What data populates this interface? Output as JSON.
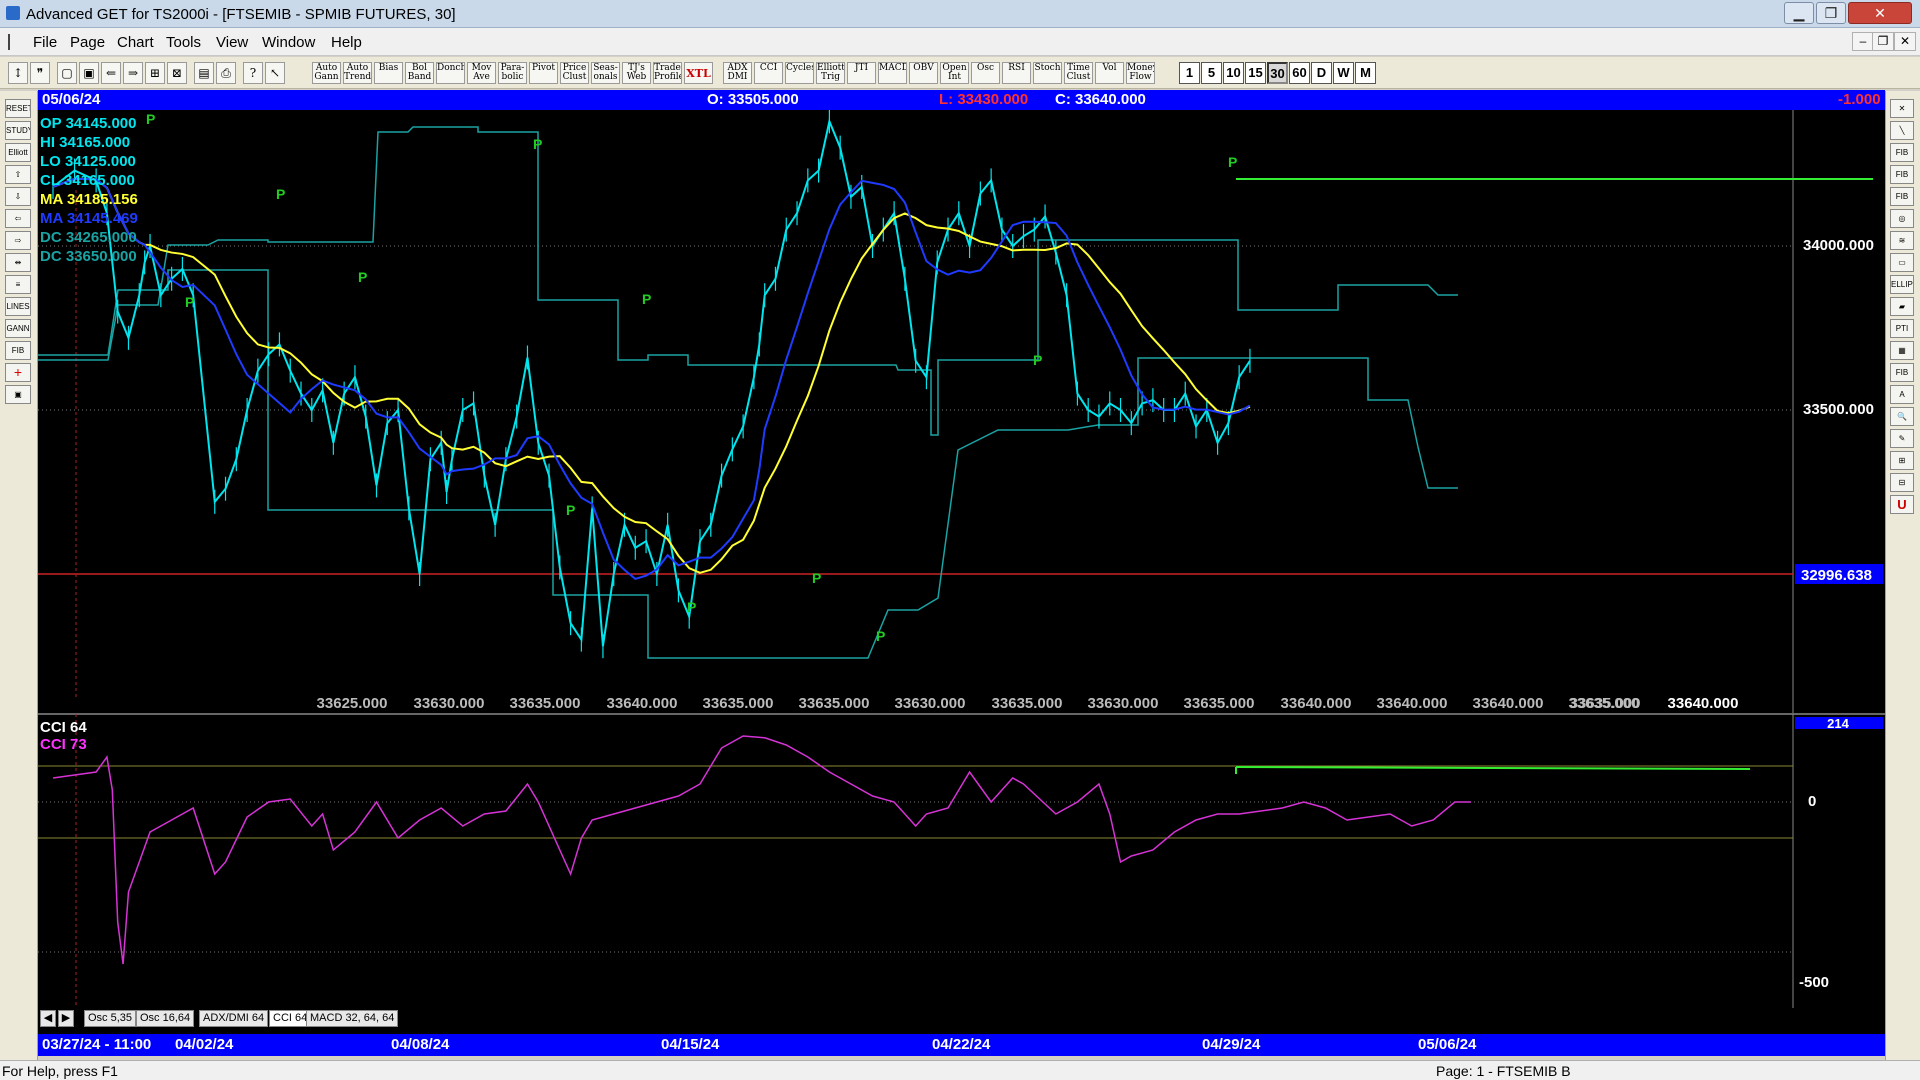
{
  "window": {
    "title": "Advanced GET for TS2000i - [FTSEMIB - SPMIB FUTURES, 30]",
    "minimize": "▁",
    "maximize": "❐",
    "close": "✕"
  },
  "menu": [
    "File",
    "Page",
    "Chart",
    "Tools",
    "View",
    "Window",
    "Help"
  ],
  "mdi_buttons": [
    "‒",
    "❐",
    "✕"
  ],
  "toolbar": {
    "studies": [
      "Auto Gann",
      "Auto Trend",
      "Bias",
      "Bol Band",
      "Donch",
      "Mov Ave",
      "Para- bolic",
      "Pivot",
      "Price Clust",
      "Seas- onals",
      "TJ's Web",
      "Trade Profile",
      "XTL",
      "ADX DMI",
      "CCI",
      "Cycles",
      "Elliott Trig",
      "JTI",
      "MACD",
      "OBV",
      "Open Int",
      "Osc",
      "RSI",
      "Stoch",
      "Time Clust",
      "Vol",
      "Money Flow"
    ],
    "timeframes": [
      "1",
      "5",
      "10",
      "15",
      "30",
      "60",
      "D",
      "W",
      "M"
    ],
    "active_timeframe": "30"
  },
  "left_tools": [
    "RESET",
    "STUDY",
    "Elliott",
    "⇧",
    "⇩",
    "⇦",
    "⇨",
    "⇹",
    "≡",
    "LINES",
    "GANN",
    "FIB",
    "+",
    "▣"
  ],
  "right_tools": [
    "✕",
    "╲",
    "FIB RET",
    "FIB EXT",
    "FIB TIME",
    "◎",
    "≋",
    "▭",
    "ELLIPS",
    "▰",
    "PTI",
    "▦",
    "FIB",
    "A",
    "🔍",
    "✎",
    "⊞",
    "⊟",
    "U"
  ],
  "infobar": {
    "date": "05/06/24",
    "open": "O: 33505.000",
    "low": "L: 33430.000",
    "close": "C: 33640.000",
    "change": "-1.000"
  },
  "legend": [
    {
      "text": "OP  34145.000",
      "color": "#00e5ee"
    },
    {
      "text": "HI   34165.000",
      "color": "#00e5ee"
    },
    {
      "text": "LO  34125.000",
      "color": "#00e5ee"
    },
    {
      "text": "CL  34165.000",
      "color": "#00e5ee"
    },
    {
      "text": "MA  34185.156",
      "color": "#ffff33"
    },
    {
      "text": "MA  34145.469",
      "color": "#1f3bff"
    },
    {
      "text": "DC  34265.000",
      "color": "#1aa3a3"
    },
    {
      "text": "DC  33650.000",
      "color": "#1aa3a3"
    }
  ],
  "cci_legend": [
    {
      "text": "CCI 64",
      "color": "#ffffff"
    },
    {
      "text": "CCI  73",
      "color": "#ff33ff"
    }
  ],
  "price_labels": [
    "34000.000",
    "33500.000"
  ],
  "red_line_value": "32996.638",
  "cci_labels": [
    "214",
    "0",
    "-500"
  ],
  "bottom_values": [
    "33625.000",
    "33630.000",
    "33635.000",
    "33640.000",
    "33635.000",
    "33635.000",
    "33630.000",
    "33635.000",
    "33630.000",
    "33635.000",
    "33640.000",
    "33640.000",
    "33640.000",
    "33635.000",
    "33640.000"
  ],
  "tabs": [
    "Osc 5,35",
    "Osc 16,64",
    "ADX/DMI 64",
    "CCI 64",
    "MACD 32, 64, 64"
  ],
  "dates": [
    "03/27/24 - 11:00",
    "04/02/24",
    "04/08/24",
    "04/15/24",
    "04/22/24",
    "04/29/24",
    "05/06/24"
  ],
  "status": {
    "help": "For Help, press F1",
    "page": "Page: 1 - FTSEMIB B"
  },
  "chart_data": [
    {
      "type": "line",
      "name": "price",
      "x": [
        0,
        4,
        8,
        10,
        12,
        14,
        16,
        17,
        18,
        20,
        22,
        24,
        26,
        30,
        32,
        34,
        36,
        38,
        40,
        42,
        44,
        46,
        48,
        50,
        52,
        54,
        56,
        58,
        60,
        62,
        64,
        66,
        68,
        70,
        72,
        73,
        74,
        76,
        78,
        80,
        82,
        84,
        86,
        88,
        90,
        92,
        94,
        96,
        98,
        100,
        102,
        104,
        106,
        108,
        110,
        112,
        114,
        116,
        118,
        120,
        122,
        124,
        126,
        128,
        130,
        131,
        132,
        134,
        136,
        138,
        140,
        142,
        144,
        146,
        148,
        150,
        152,
        154,
        156,
        158,
        160,
        162,
        164,
        166,
        168,
        170,
        172,
        174,
        176,
        178,
        180,
        182,
        184,
        186,
        188,
        190,
        192,
        194,
        196,
        198,
        200,
        202,
        204,
        206,
        208,
        210,
        212,
        214,
        216,
        218,
        220,
        222,
        224,
        226,
        228,
        230,
        232,
        234,
        236,
        238,
        240,
        242,
        244,
        246,
        248,
        250,
        252,
        254,
        256,
        258,
        260,
        262,
        263
      ],
      "y": [
        34180,
        34230,
        34200,
        34100,
        33800,
        33720,
        33850,
        33950,
        34000,
        33850,
        33900,
        33930,
        33850,
        33220,
        33260,
        33350,
        33500,
        33620,
        33670,
        33700,
        33620,
        33550,
        33500,
        33560,
        33400,
        33550,
        33600,
        33480,
        33270,
        33460,
        33500,
        33200,
        33000,
        33350,
        33400,
        33250,
        33350,
        33500,
        33520,
        33300,
        33150,
        33350,
        33480,
        33660,
        33400,
        33300,
        33020,
        32850,
        32800,
        33200,
        32780,
        33000,
        33150,
        33080,
        33100,
        33000,
        33150,
        32950,
        32870,
        33100,
        33150,
        33300,
        33380,
        33450,
        33600,
        33700,
        33850,
        33900,
        34050,
        34100,
        34200,
        34230,
        34380,
        34300,
        34150,
        34180,
        34000,
        34050,
        34100,
        33900,
        33650,
        33600,
        33950,
        34050,
        34100,
        34000,
        34160,
        34200,
        34050,
        34000,
        34030,
        34050,
        34090,
        33980,
        33850,
        33550,
        33500,
        33480,
        33520,
        33500,
        33460,
        33520,
        33530,
        33500,
        33500,
        33550,
        33450,
        33500,
        33400,
        33460,
        33600,
        33650
      ]
    },
    {
      "type": "line",
      "name": "CCI",
      "x": [
        0,
        4,
        8,
        10,
        11,
        12,
        13,
        14,
        16,
        18,
        20,
        24,
        26,
        30,
        32,
        36,
        40,
        44,
        48,
        50,
        52,
        56,
        60,
        64,
        68,
        72,
        76,
        80,
        84,
        88,
        90,
        96,
        98,
        100,
        104,
        108,
        112,
        116,
        120,
        124,
        128,
        132,
        136,
        140,
        144,
        148,
        152,
        156,
        160,
        162,
        166,
        170,
        174,
        178,
        180,
        186,
        190,
        194,
        196,
        198,
        200,
        204,
        208,
        212,
        216,
        220,
        224,
        228,
        232,
        236,
        240,
        244,
        248,
        252,
        256,
        260,
        263
      ],
      "y": [
        80,
        90,
        100,
        150,
        40,
        -400,
        -540,
        -300,
        -200,
        -100,
        -80,
        -40,
        -20,
        -240,
        -200,
        -50,
        0,
        10,
        -80,
        -40,
        -160,
        -100,
        0,
        -120,
        -60,
        -20,
        -80,
        -40,
        -30,
        60,
        0,
        -240,
        -120,
        -60,
        -40,
        -20,
        0,
        20,
        60,
        180,
        220,
        214,
        190,
        150,
        100,
        60,
        20,
        0,
        -80,
        -40,
        -20,
        100,
        0,
        80,
        60,
        -40,
        0,
        60,
        -40,
        -200,
        -180,
        -160,
        -100,
        -60,
        -40,
        -40,
        -30,
        -20,
        0,
        -20,
        -60,
        -50,
        -40,
        -80,
        -60,
        0,
        0
      ]
    }
  ]
}
